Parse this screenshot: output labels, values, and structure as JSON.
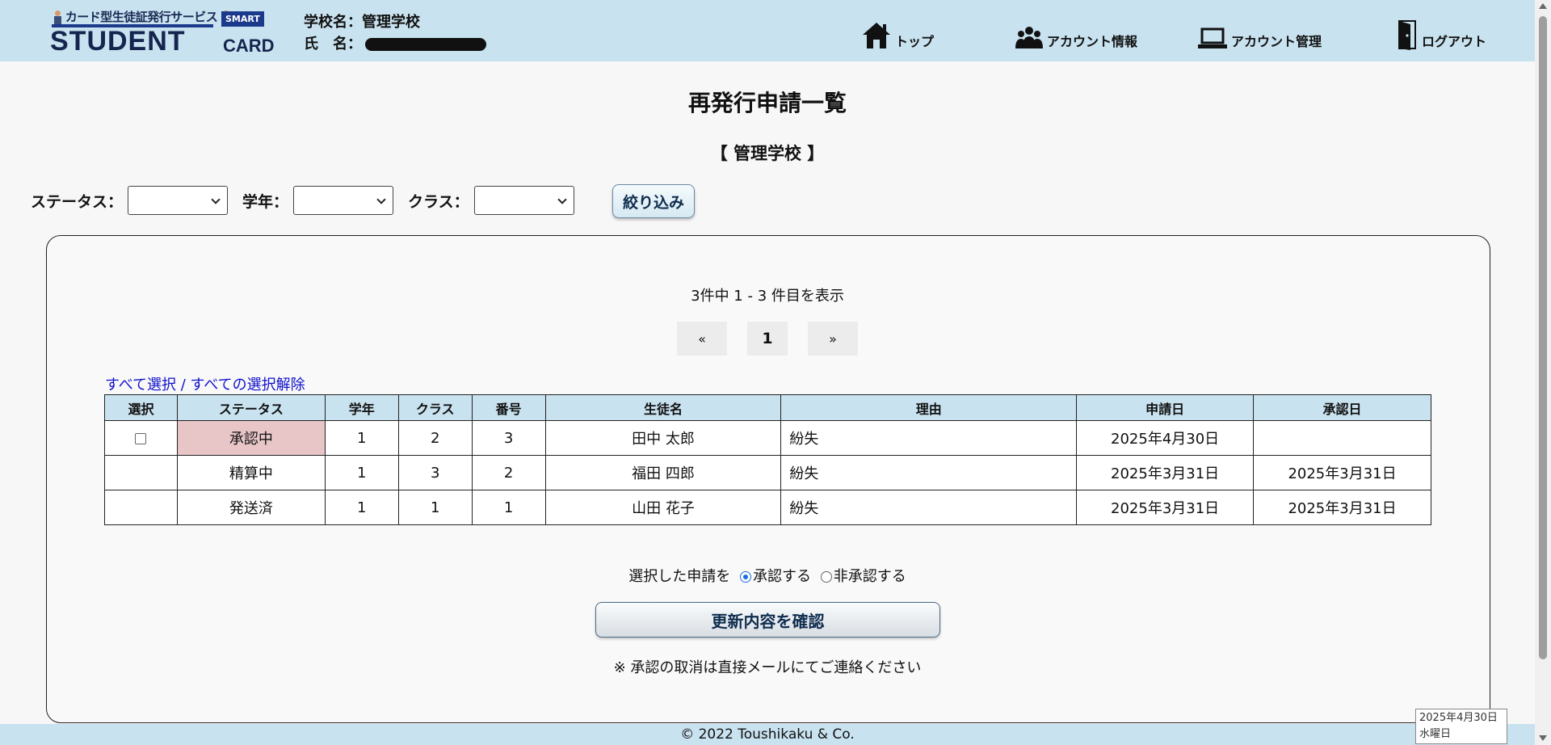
{
  "header": {
    "logo_tagline": "カード型生徒証発行サービス",
    "logo_badge": "SMART",
    "logo_main": "STUDENT",
    "logo_sub": "CARD",
    "school_label": "学校名：",
    "school_value": "管理学校",
    "name_label": "氏　名：",
    "nav": {
      "top": "トップ",
      "account_info": "アカウント情報",
      "account_mgmt": "アカウント管理",
      "logout": "ログアウト"
    }
  },
  "page": {
    "title": "再発行申請一覧",
    "school_name": "【 管理学校 】"
  },
  "filter": {
    "status_label": "ステータス：",
    "grade_label": "学年：",
    "class_label": "クラス：",
    "status_value": "",
    "grade_value": "",
    "class_value": "",
    "button": "絞り込み"
  },
  "list": {
    "count_text": "3件中 1 - 3 件目を表示",
    "pager": {
      "prev": "«",
      "current": "1",
      "next": "»"
    },
    "select_all": "すべて選択",
    "separator": " / ",
    "deselect_all": "すべての選択解除",
    "columns": [
      "選択",
      "ステータス",
      "学年",
      "クラス",
      "番号",
      "生徒名",
      "理由",
      "申請日",
      "承認日"
    ],
    "rows": [
      {
        "status": "承認中",
        "grade": "1",
        "class": "2",
        "number": "3",
        "name": "田中 太郎",
        "reason": "紛失",
        "applied": "2025年4月30日",
        "approved": ""
      },
      {
        "status": "精算中",
        "grade": "1",
        "class": "3",
        "number": "2",
        "name": "福田 四郎",
        "reason": "紛失",
        "applied": "2025年3月31日",
        "approved": "2025年3月31日"
      },
      {
        "status": "発送済",
        "grade": "1",
        "class": "1",
        "number": "1",
        "name": "山田 花子",
        "reason": "紛失",
        "applied": "2025年3月31日",
        "approved": "2025年3月31日"
      }
    ]
  },
  "action": {
    "prefix": "選択した申請を",
    "approve": "承認する",
    "reject": "非承認する",
    "selected": "approve",
    "confirm_button": "更新内容を確認",
    "note": "※ 承認の取消は直接メールにてご連絡ください"
  },
  "footer": {
    "copyright": "© 2022 Toushikaku & Co."
  },
  "tooltip": {
    "line1": "2025年4月30日",
    "line2": "水曜日"
  },
  "colors": {
    "header_bg": "#c8e2ef",
    "pending_bg": "#e8c6c8",
    "link": "#1010cc"
  }
}
